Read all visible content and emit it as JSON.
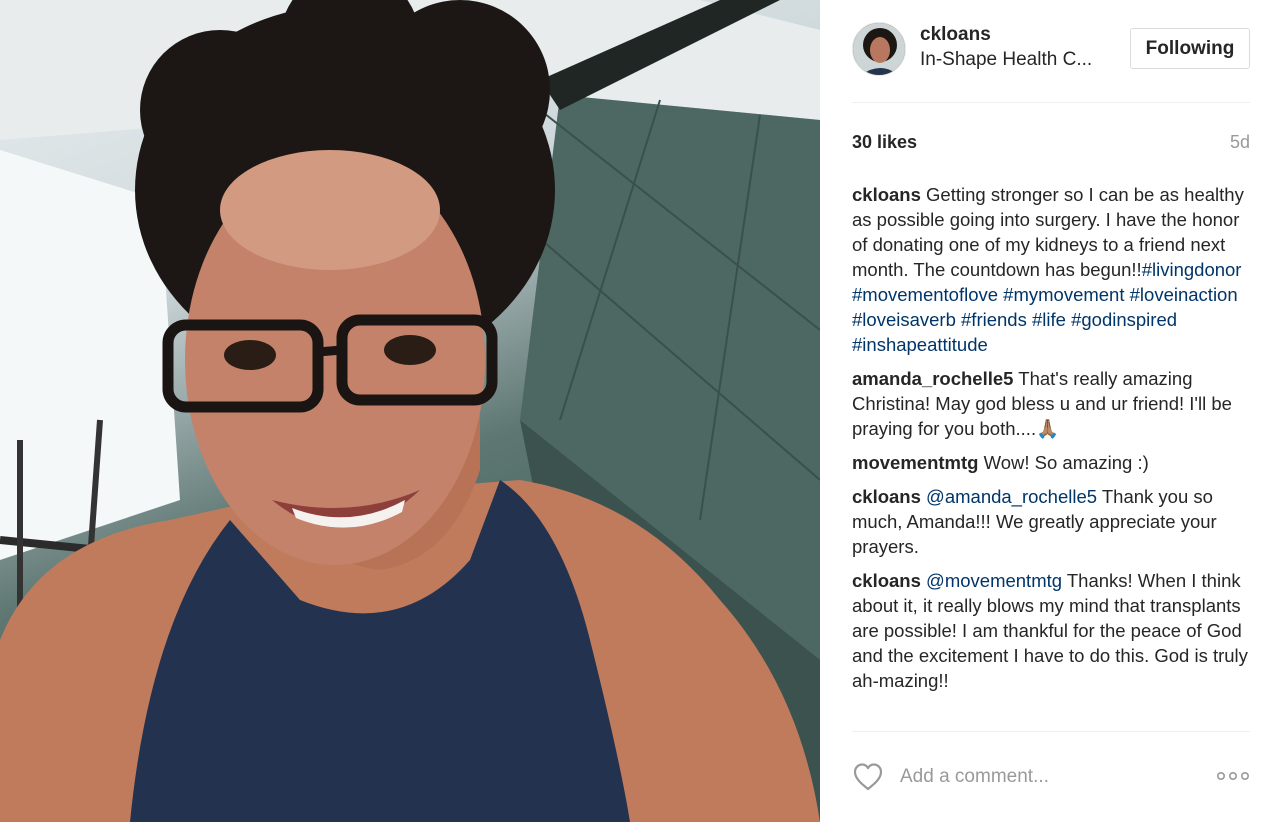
{
  "post": {
    "owner": {
      "username": "ckloans",
      "location": "In-Shape Health C..."
    },
    "follow_label": "Following",
    "likes": "30 likes",
    "time_ago": "5d",
    "comments": [
      {
        "user": "ckloans",
        "segments": [
          {
            "text": "Getting stronger so I can be as healthy as possible going into surgery. I have the honor of donating one of my kidneys to a friend next month. The countdown has begun!!"
          },
          {
            "text": "#livingdonor",
            "tag": true
          },
          {
            "text": " "
          },
          {
            "text": "#movementoflove",
            "tag": true
          },
          {
            "text": " "
          },
          {
            "text": "#mymovement",
            "tag": true
          },
          {
            "text": " "
          },
          {
            "text": "#loveinaction",
            "tag": true
          },
          {
            "text": " "
          },
          {
            "text": "#loveisaverb",
            "tag": true
          },
          {
            "text": " "
          },
          {
            "text": "#friends",
            "tag": true
          },
          {
            "text": " "
          },
          {
            "text": "#life",
            "tag": true
          },
          {
            "text": " "
          },
          {
            "text": "#godinspired",
            "tag": true
          },
          {
            "text": " "
          },
          {
            "text": "#inshapeattitude",
            "tag": true
          }
        ]
      },
      {
        "user": "amanda_rochelle5",
        "segments": [
          {
            "text": "That's really amazing Christina! May god bless u and ur friend! I'll be praying for you both....🙏🏽"
          }
        ]
      },
      {
        "user": "movementmtg",
        "segments": [
          {
            "text": "Wow! So amazing :)"
          }
        ]
      },
      {
        "user": "ckloans",
        "segments": [
          {
            "text": "@amanda_rochelle5",
            "tag": true
          },
          {
            "text": " Thank you so much, Amanda!!! We greatly appreciate your prayers."
          }
        ]
      },
      {
        "user": "ckloans",
        "segments": [
          {
            "text": "@movementmtg",
            "tag": true
          },
          {
            "text": " Thanks! When I think about it, it really blows my mind that transplants are possible! I am thankful for the peace of God and the excitement I have to do this. God is truly ah-mazing!!"
          }
        ]
      }
    ],
    "comment_placeholder": "Add a comment...",
    "icons": {
      "like": "heart-outline-icon",
      "more": "more-options-icon"
    },
    "colors": {
      "hashtag": "#003569",
      "muted": "#999999",
      "text": "#262626",
      "border": "#dbdbdb"
    }
  }
}
